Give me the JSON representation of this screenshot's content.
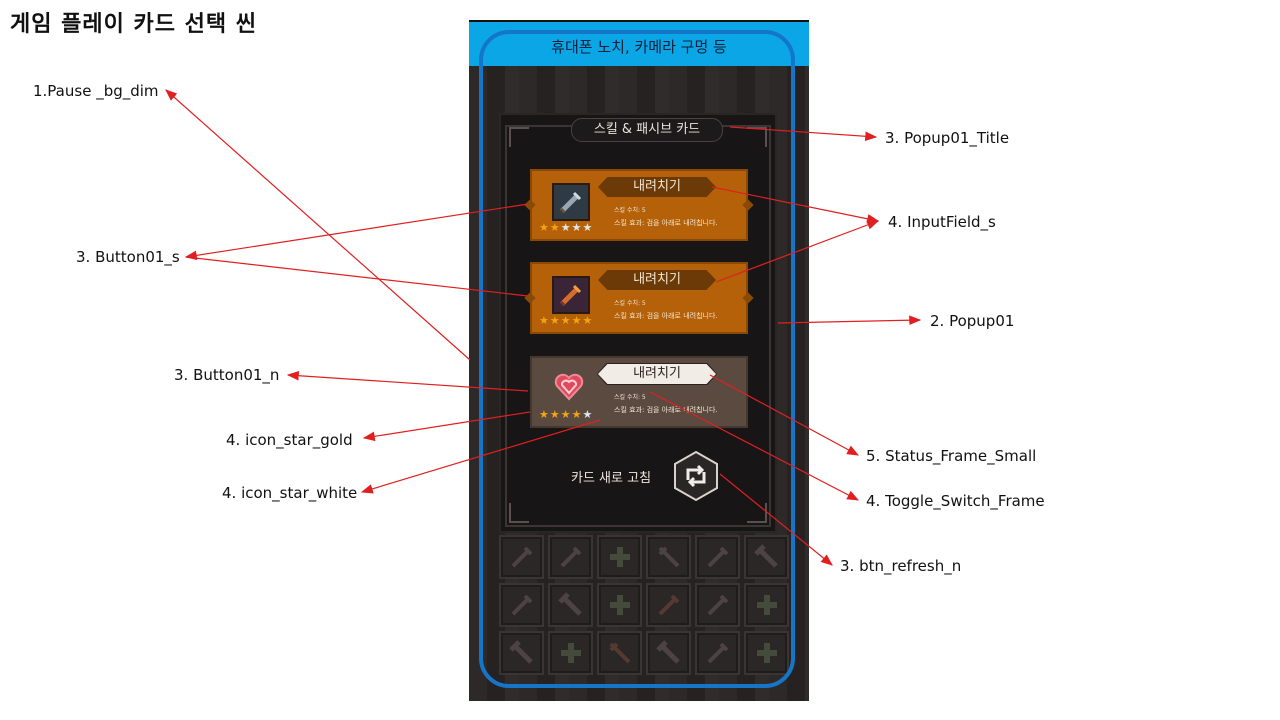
{
  "title": "게임 플레이 카드 선택  씬",
  "annotations": {
    "pause_bg_dim": "1.Pause _bg_dim",
    "popup01_title": "3. Popup01_Title",
    "inputfield_s": "4. InputField_s",
    "button01_s": "3. Button01_s",
    "popup01": "2. Popup01",
    "button01_n": "3. Button01_n",
    "icon_star_gold": "4. icon_star_gold",
    "icon_star_white": "4. icon_star_white",
    "status_frame_small": "5. Status_Frame_Small",
    "toggle_switch_frame": "4. Toggle_Switch_Frame",
    "btn_refresh_n": "3. btn_refresh_n"
  },
  "phone": {
    "notch_label": "휴대폰 노치, 카메라 구멍 등"
  },
  "popup": {
    "title": "스킬 & 패시브 카드",
    "cards": [
      {
        "name": "내려치기",
        "stat": "스킬 수치: 5",
        "effect": "스킬 효과: 검을 아래로 내려칩니다.",
        "icon": "sword-icon",
        "stars": [
          "gold",
          "gold",
          "white",
          "white",
          "white"
        ]
      },
      {
        "name": "내려치기",
        "stat": "스킬 수치: 5",
        "effect": "스킬 효과: 검을 아래로 내려칩니다.",
        "icon": "fire-sword-icon",
        "stars": [
          "gold",
          "gold",
          "gold",
          "gold",
          "gold"
        ]
      },
      {
        "name": "내려치기",
        "stat": "스킬 수치: 5",
        "effect": "스킬 효과: 검을 아래로 내려칩니다.",
        "icon": "heart-icon",
        "stars": [
          "gold",
          "gold",
          "gold",
          "gold",
          "white"
        ]
      }
    ],
    "refresh_label": "카드 새로 고침"
  },
  "colors": {
    "notch": "#0aa6e6",
    "safe_frame": "#1576c9",
    "card_selected": "#b4610a",
    "card_normal": "#5a4a40",
    "arrow": "#e02020",
    "star_gold": "#f2a414",
    "star_white": "#dfe6ec"
  }
}
